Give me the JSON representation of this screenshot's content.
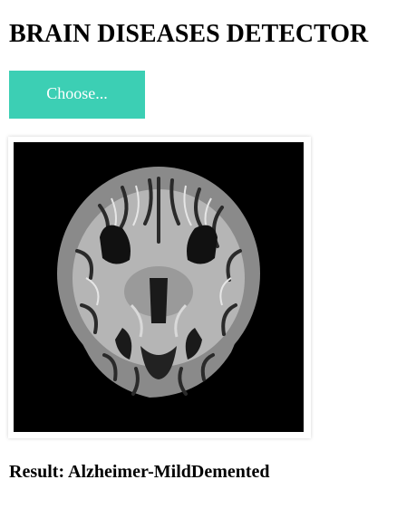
{
  "header": {
    "title": "BRAIN DISEASES DETECTOR"
  },
  "upload": {
    "button_label": "Choose..."
  },
  "result": {
    "text": "Result: Alzheimer-MildDemented"
  },
  "colors": {
    "accent": "#3ccfb4",
    "button_text": "#ffffff",
    "image_background": "#000000"
  }
}
